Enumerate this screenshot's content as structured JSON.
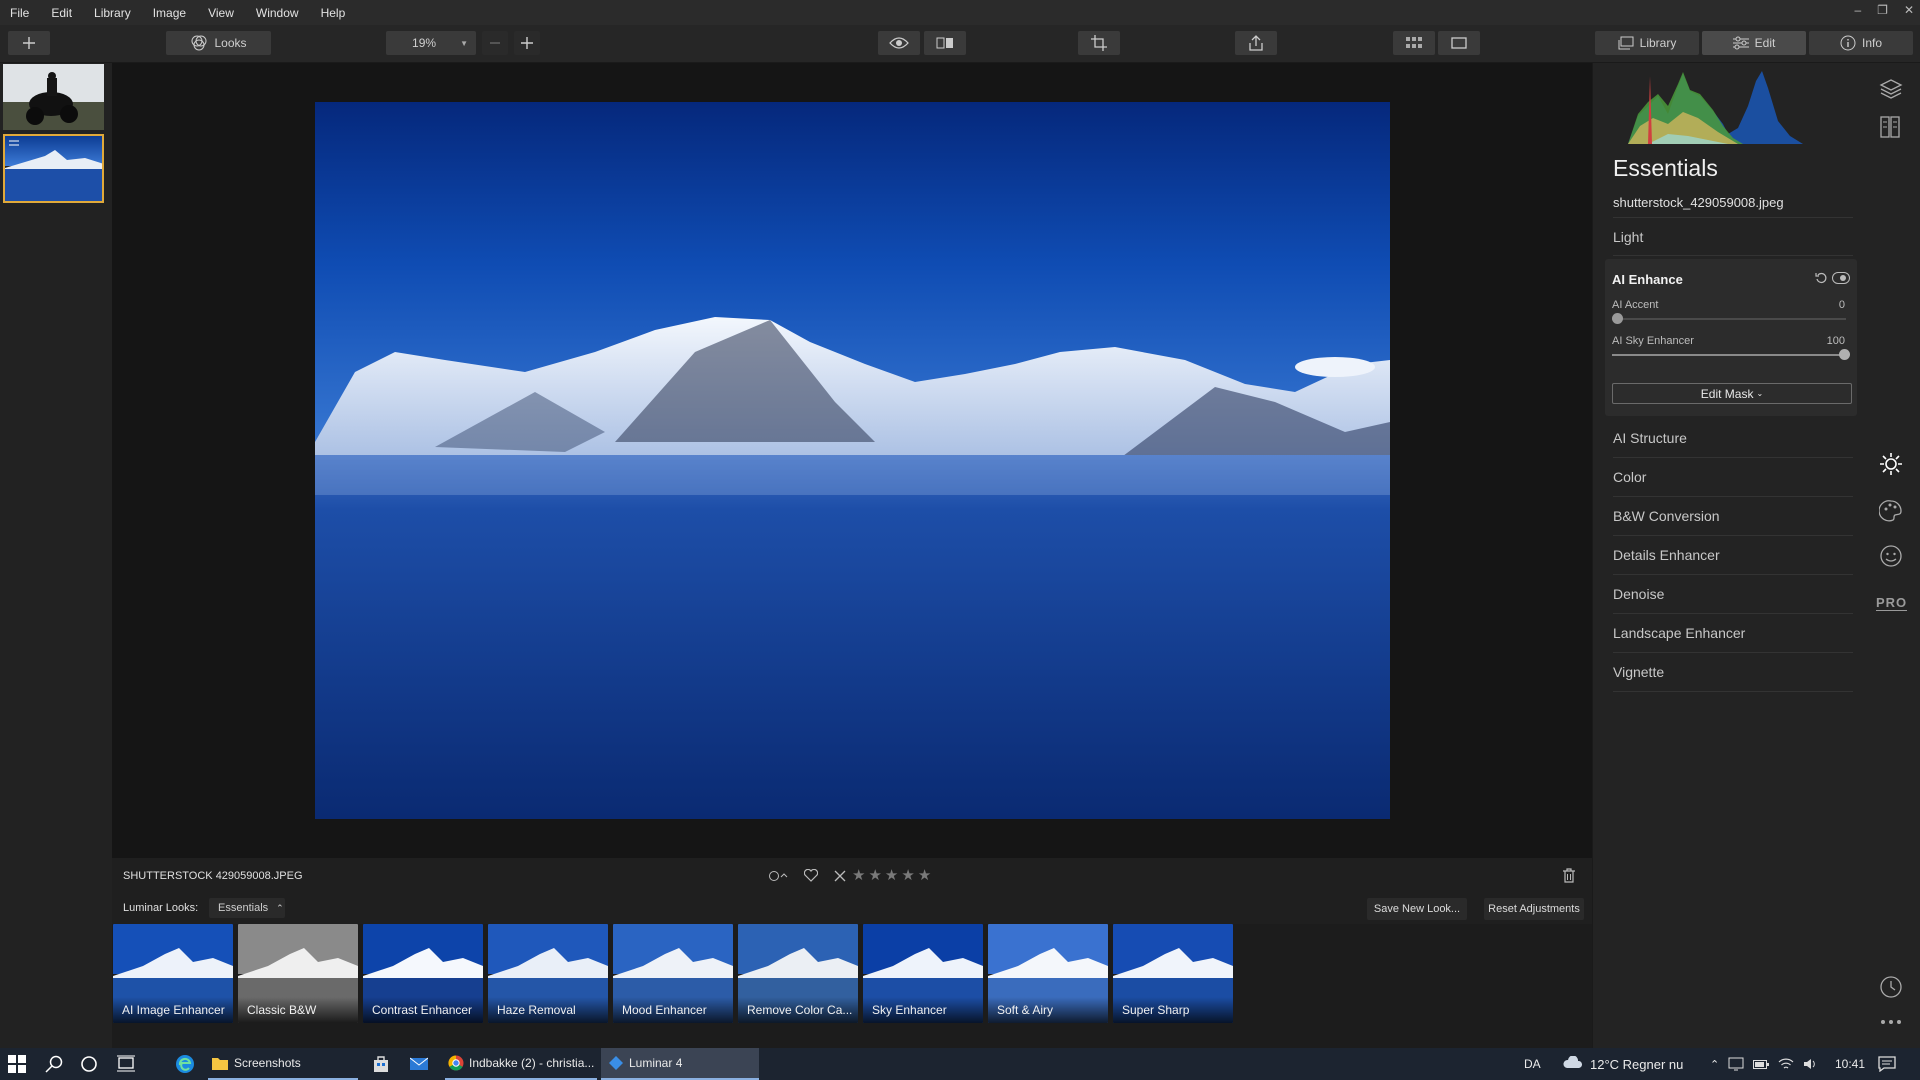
{
  "menu": [
    "File",
    "Edit",
    "Library",
    "Image",
    "View",
    "Window",
    "Help"
  ],
  "toolbar": {
    "looks_label": "Looks",
    "zoom": "19%",
    "library_tab": "Library",
    "edit_tab": "Edit",
    "info_tab": "Info"
  },
  "image": {
    "filename_upper": "SHUTTERSTOCK 429059008.JPEG"
  },
  "looks": {
    "label": "Luminar Looks:",
    "category": "Essentials",
    "save_new": "Save New Look...",
    "reset": "Reset Adjustments",
    "items": [
      "AI Image Enhancer",
      "Classic B&W",
      "Contrast Enhancer",
      "Haze Removal",
      "Mood Enhancer",
      "Remove Color Ca...",
      "Sky Enhancer",
      "Soft & Airy",
      "Super Sharp"
    ]
  },
  "panel": {
    "title": "Essentials",
    "filename": "shutterstock_429059008.jpeg",
    "light": "Light",
    "ai_enhance": {
      "title": "AI Enhance",
      "accent_label": "AI Accent",
      "accent_value": "0",
      "sky_label": "AI Sky Enhancer",
      "sky_value": "100",
      "edit_mask": "Edit Mask"
    },
    "sections": [
      "AI Structure",
      "Color",
      "B&W Conversion",
      "Details Enhancer",
      "Denoise",
      "Landscape Enhancer",
      "Vignette"
    ],
    "pro": "PRO"
  },
  "taskbar": {
    "screenshots": "Screenshots",
    "chrome": "Indbakke (2) - christia...",
    "luminar": "Luminar 4",
    "lang": "DA",
    "weather": "12°C  Regner nu",
    "time": "10:41"
  }
}
